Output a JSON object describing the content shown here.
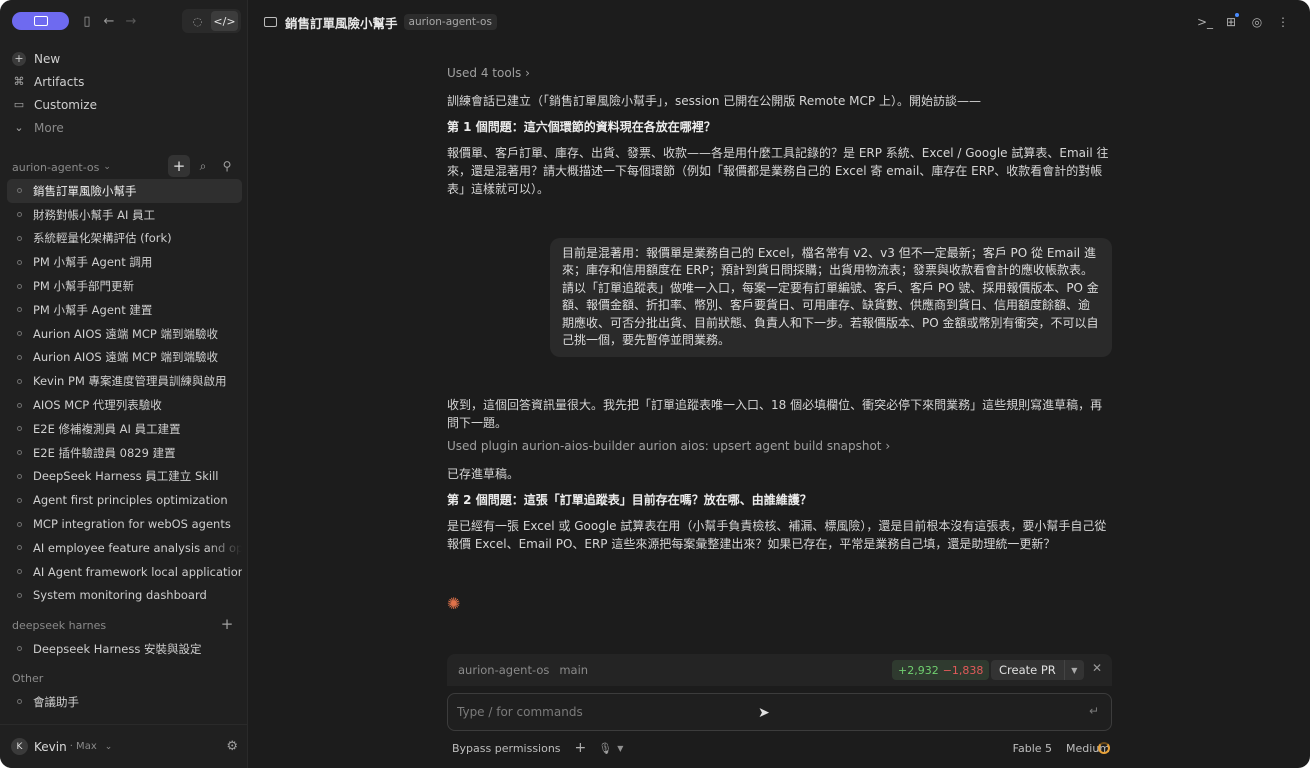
{
  "sidebar": {
    "nav": [
      {
        "label": "New",
        "icon": "plus-icon"
      },
      {
        "label": "Artifacts",
        "icon": "artifacts-icon"
      },
      {
        "label": "Customize",
        "icon": "briefcase-icon"
      },
      {
        "label": "More",
        "icon": "chevron-down-icon"
      }
    ],
    "project_section": {
      "label": "aurion-agent-os"
    },
    "conversations": [
      "銷售訂單風險小幫手",
      "財務對帳小幫手 AI 員工",
      "系統輕量化架構評估 (fork)",
      "PM 小幫手 Agent 調用",
      "PM 小幫手部門更新",
      "PM 小幫手 Agent 建置",
      "Aurion AIOS 遠端 MCP 端到端驗收",
      "Aurion AIOS 遠端 MCP 端到端驗收",
      "Kevin PM 專案進度管理員訓練與啟用",
      "AIOS MCP 代理列表驗收",
      "E2E 修補複測員 AI 員工建置",
      "E2E 插件驗證員 0829 建置",
      "DeepSeek Harness 員工建立 Skill",
      "Agent first principles optimization",
      "MCP integration for webOS agents",
      "AI employee feature analysis and optimization",
      "AI Agent framework local application",
      "System monitoring dashboard"
    ],
    "deepseek_section": {
      "label": "deepseek harnes",
      "items": [
        "Deepseek Harness 安裝與設定"
      ]
    },
    "other_section": {
      "label": "Other",
      "items": [
        "會議助手"
      ]
    },
    "user": {
      "initial": "K",
      "name": "Kevin",
      "plan": "· Max"
    }
  },
  "header": {
    "title": "銷售訂單風險小幫手",
    "tag": "aurion-agent-os"
  },
  "chat": {
    "tools_used": "Used 4 tools",
    "msg1": "訓練會話已建立（「銷售訂單風險小幫手」，session 已開在公開版 Remote MCP 上）。開始訪談——",
    "q1_title": "第 1 個問題：這六個環節的資料現在各放在哪裡？",
    "q1_body": "報價單、客戶訂單、庫存、出貨、發票、收款——各是用什麼工具記錄的？是 ERP 系統、Excel / Google 試算表、Email 往來，還是混著用？請大概描述一下每個環節（例如「報價都是業務自己的 Excel 寄 email、庫存在 ERP、收款看會計的對帳表」這樣就可以）。",
    "user_reply": "目前是混著用：報價單是業務自己的 Excel，檔名常有 v2、v3 但不一定最新；客戶 PO 從 Email 進來；庫存和信用額度在 ERP；預計到貨日問採購；出貨用物流表；發票與收款看會計的應收帳款表。請以「訂單追蹤表」做唯一入口，每案一定要有訂單編號、客戶、客戶 PO 號、採用報價版本、PO 金額、報價金額、折扣率、幣別、客戶要貨日、可用庫存、缺貨數、供應商到貨日、信用額度餘額、逾期應收、可否分批出貨、目前狀態、負責人和下一步。若報價版本、PO 金額或幣別有衝突，不可以自己挑一個，要先暫停並問業務。",
    "msg2": "收到，這個回答資訊量很大。我先把「訂單追蹤表唯一入口、18 個必填欄位、衝突必停下來問業務」這些規則寫進草稿，再問下一題。",
    "plugin_used": "Used plugin aurion-aios-builder aurion aios: upsert agent build snapshot",
    "saved": "已存進草稿。",
    "q2_title": "第 2 個問題：這張「訂單追蹤表」目前存在嗎？放在哪、由誰維護？",
    "q2_body": "是已經有一張 Excel 或 Google 試算表在用（小幫手負責檢核、補漏、標風險），還是目前根本沒有這張表，要小幫手自己從報價 Excel、Email PO、ERP 這些來源把每案彙整建出來？如果已存在，平常是業務自己填，還是助理統一更新？"
  },
  "branch": {
    "repo": "aurion-agent-os",
    "name": "main",
    "additions": "+2,932",
    "deletions": "−1,838",
    "create_pr": "Create PR"
  },
  "composer": {
    "placeholder": "Type / for commands",
    "permissions": "Bypass permissions",
    "model": "Fable 5",
    "effort": "Medium"
  },
  "colors": {
    "accent": "#6e6af0",
    "add": "#6fcf6f",
    "del": "#e05a5a",
    "spark": "#e0724a"
  }
}
